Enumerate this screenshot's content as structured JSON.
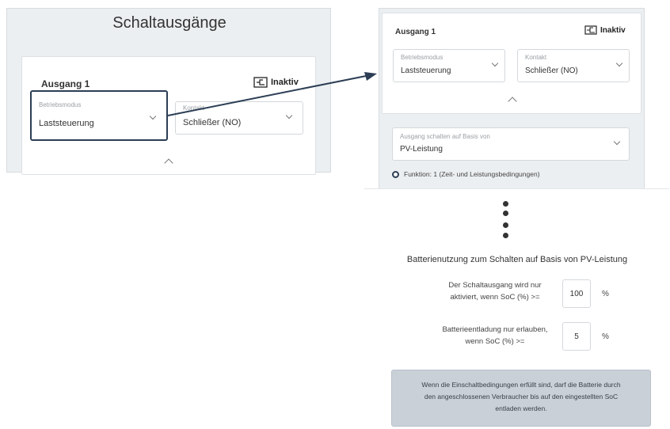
{
  "left_panel": {
    "heading": "Schaltausgänge",
    "card_title": "Ausgang 1",
    "status_label": "Inaktiv",
    "mode_select": {
      "label": "Betriebsmodus",
      "value": "Laststeuerung"
    },
    "contact_select": {
      "label": "Kontakt",
      "value": "Schließer (NO)"
    }
  },
  "right_panel": {
    "card_title": "Ausgang 1",
    "status_label": "Inaktiv",
    "mode_select": {
      "label": "Betriebsmodus",
      "value": "Laststeuerung"
    },
    "contact_select": {
      "label": "Kontakt",
      "value": "Schließer (NO)"
    },
    "basis_select": {
      "label": "Ausgang schalten auf Basis von",
      "value": "PV-Leistung"
    },
    "function_note": "Funktion: 1 (Zeit- und Leistungsbedingungen)"
  },
  "battery_section": {
    "title": "Batterienutzung zum Schalten auf Basis von PV-Leistung",
    "soc_activate": {
      "label_line1": "Der Schaltausgang wird nur",
      "label_line2": "aktiviert, wenn SoC (%) >=",
      "value": "100",
      "unit": "%"
    },
    "soc_discharge": {
      "label_line1": "Batterieentladung nur erlauben,",
      "label_line2": "wenn SoC (%) >=",
      "value": "5",
      "unit": "%"
    },
    "info_line1": "Wenn die Einschaltbedingungen erfüllt sind, darf die Batterie durch",
    "info_line2": "den angeschlossenen Verbraucher bis auf den eingestellten SoC",
    "info_line3": "entladen werden."
  },
  "colors": {
    "panel_bg": "#eceff1",
    "highlight_border": "#2c3e55",
    "arrow": "#2c3e55",
    "info_box_bg": "#c9d0d8"
  },
  "icons": [
    "inaktiv-output-icon",
    "chevron-down-icon",
    "chevron-up-icon",
    "radio-icon",
    "vertical-dots-icon",
    "arrow"
  ]
}
